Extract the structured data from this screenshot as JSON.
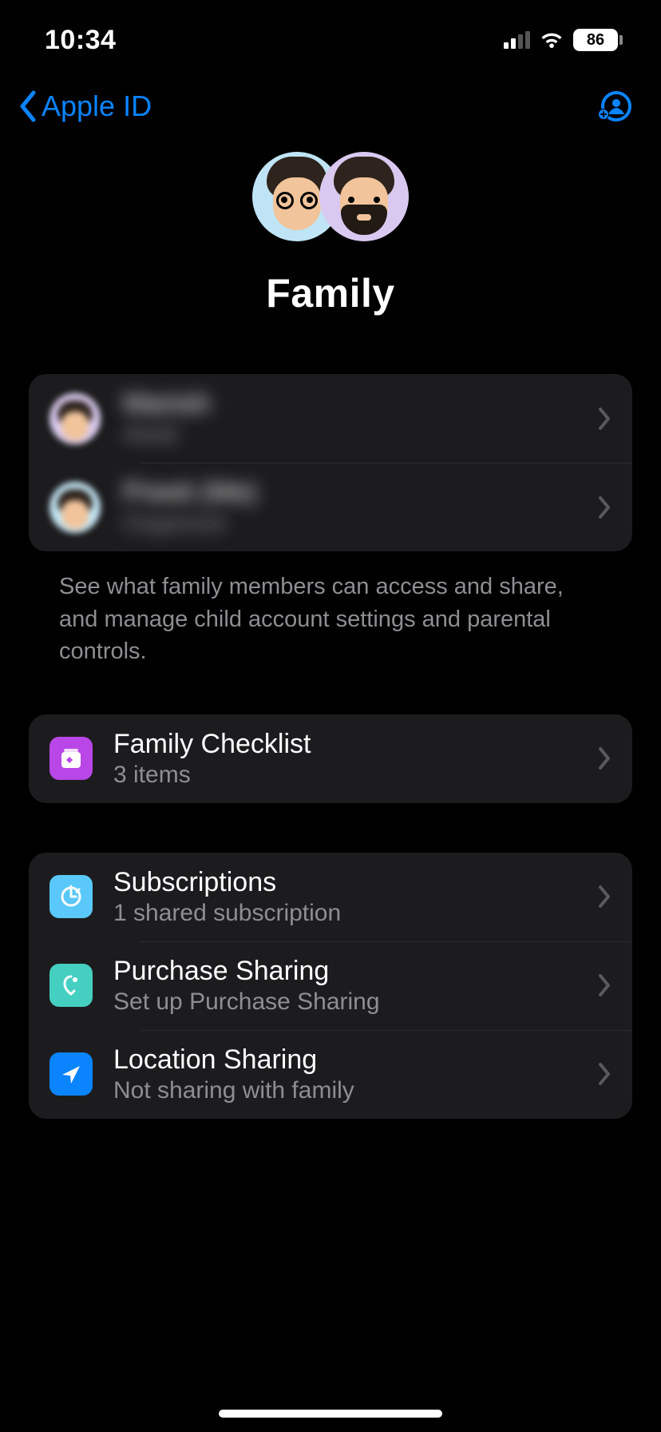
{
  "status": {
    "time": "10:34",
    "battery_pct": "86"
  },
  "nav": {
    "back_label": "Apple ID"
  },
  "header": {
    "title": "Family"
  },
  "members": [
    {
      "name": "Manish",
      "role": "Adult"
    },
    {
      "name": "Preeti (Me)",
      "role": "Organizer"
    }
  ],
  "members_caption": "See what family members can access and share, and manage child account settings and parental controls.",
  "checklist": {
    "title": "Family Checklist",
    "subtitle": "3 items"
  },
  "services": [
    {
      "title": "Subscriptions",
      "subtitle": "1 shared subscription"
    },
    {
      "title": "Purchase Sharing",
      "subtitle": "Set up Purchase Sharing"
    },
    {
      "title": "Location Sharing",
      "subtitle": "Not sharing with family"
    }
  ],
  "colors": {
    "accent": "#0a84ff",
    "group_bg": "#1c1c1e",
    "secondary_text": "#8e8e93"
  }
}
